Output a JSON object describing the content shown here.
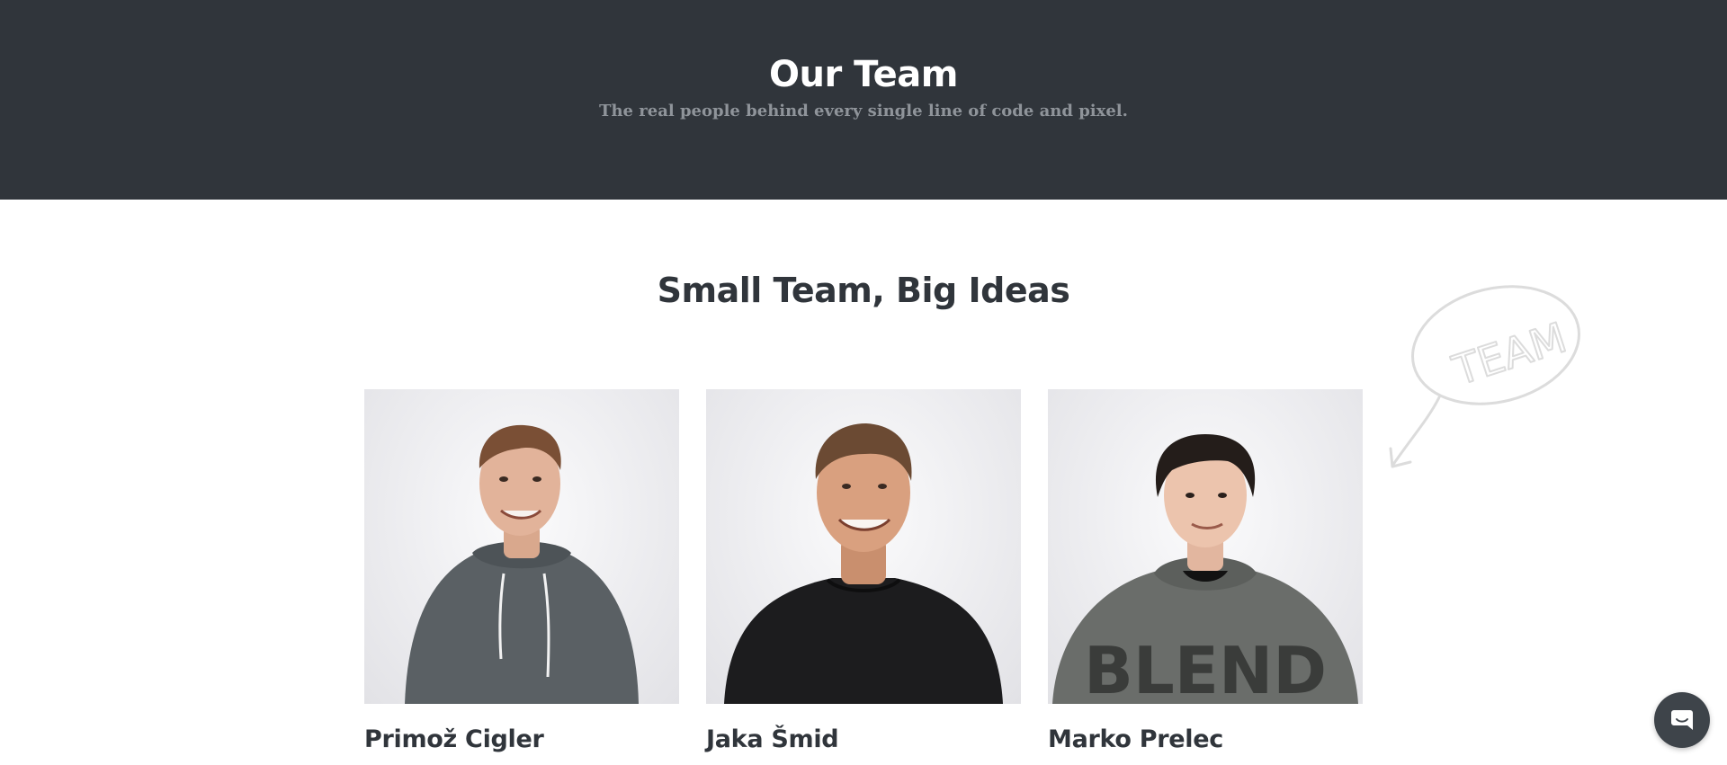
{
  "hero": {
    "title": "Our Team",
    "subtitle": "The real people behind every single line of code and pixel."
  },
  "section": {
    "title": "Small Team, Big Ideas",
    "doodle_text": "TEAM"
  },
  "team": [
    {
      "name": "Primož Cigler",
      "shirt_color": "#5a6064"
    },
    {
      "name": "Jaka Šmid",
      "shirt_color": "#1c1c1e"
    },
    {
      "name": "Marko Prelec",
      "shirt_color": "#6a6d6a",
      "shirt_text": "BLEND"
    }
  ],
  "colors": {
    "hero_bg": "#30353b",
    "hero_subtitle": "#8f949a",
    "heading": "#30353b",
    "chat_button": "#3e444a"
  },
  "icons": {
    "chat": "chat-bubble-icon"
  }
}
